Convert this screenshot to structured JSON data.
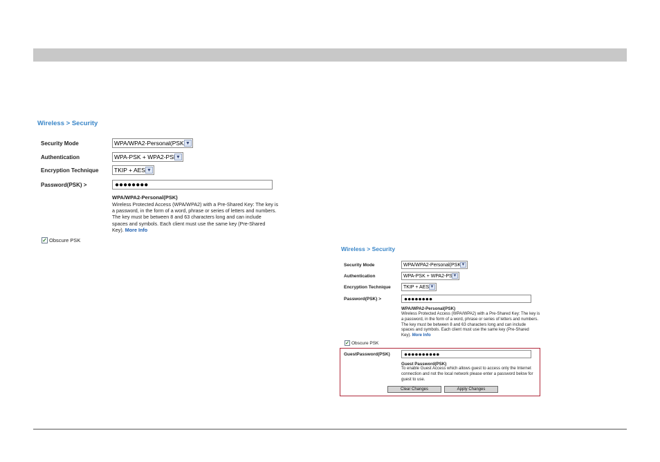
{
  "main_panel": {
    "breadcrumb": "Wireless > Security",
    "security_mode_label": "Security Mode",
    "security_mode_value": "WPA/WPA2-Personal(PSK)",
    "authentication_label": "Authentication",
    "authentication_value": "WPA-PSK + WPA2-PSK",
    "encryption_label": "Encryption Technique",
    "encryption_value": "TKIP + AES",
    "password_label": "Password(PSK) >",
    "password_value": "●●●●●●●●",
    "desc_title": "WPA/WPA2-Personal(PSK)",
    "desc_lines": [
      "Wireless Protected Access (WPA/WPA2) with a Pre-Shared Key: The key is",
      "a password, in the form of a word, phrase or series of letters and numbers.",
      "The key must be between 8 and 63 characters long and can include",
      "spaces and symbols. Each client must use the same key (Pre-Shared",
      "Key)."
    ],
    "more_info": "More Info",
    "obscure_label": "Obscure PSK"
  },
  "inset_panel": {
    "breadcrumb": "Wireless > Security",
    "security_mode_label": "Security Mode",
    "security_mode_value": "WPA/WPA2-Personal(PSK)",
    "authentication_label": "Authentication",
    "authentication_value": "WPA-PSK + WPA2-PSK",
    "encryption_label": "Encryption Technique",
    "encryption_value": "TKIP + AES",
    "password_label": "Password(PSK) >",
    "password_value": "●●●●●●●●",
    "desc_title": "WPA/WPA2-Personal(PSK)",
    "desc_lines": [
      "Wireless Protected Access (WPA/WPA2) with a Pre-Shared Key: The key is",
      "a password, in the form of a word, phrase or series of letters and numbers.",
      "The key must be between 8 and 63 characters long and can include",
      "spaces and symbols. Each client must use the same key (Pre-Shared",
      "Key)."
    ],
    "more_info": "More Info",
    "obscure_label": "Obscure PSK",
    "guest_label": "GuestPassword(PSK)",
    "guest_value": "●●●●●●●●●●",
    "guest_title": "Guest Password(PSK)",
    "guest_lines": [
      "To enable Guest Access which allows guest to access only the Internet",
      "connection and not the local network please enter a password below for",
      "guest to use."
    ],
    "clear_button": "Clear Changes",
    "apply_button": "Apply Changes"
  },
  "colors": {
    "breadcrumb": "#3a86c8",
    "guest_border": "#b0283a",
    "header_bar": "#c8c8c8"
  }
}
